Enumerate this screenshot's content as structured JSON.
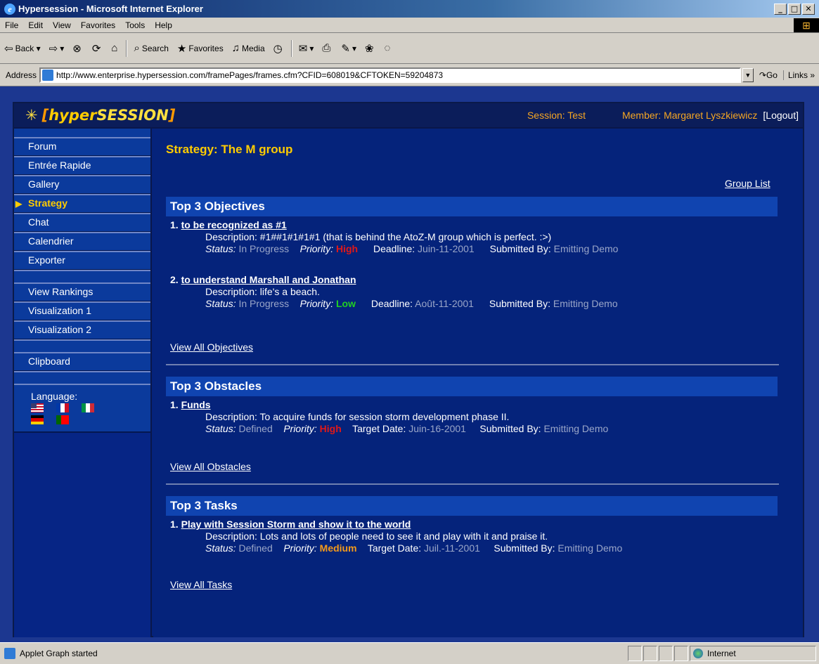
{
  "window": {
    "title": "Hypersession - Microsoft Internet Explorer"
  },
  "menu": [
    "File",
    "Edit",
    "View",
    "Favorites",
    "Tools",
    "Help"
  ],
  "toolbar": {
    "back": "Back",
    "search": "Search",
    "favorites": "Favorites",
    "media": "Media"
  },
  "address": {
    "label": "Address",
    "url": "http://www.enterprise.hypersession.com/framePages/frames.cfm?CFID=608019&CFTOKEN=59204873",
    "go": "Go",
    "links": "Links"
  },
  "header": {
    "logo_open": "[",
    "logo_hyper": "hyper",
    "logo_session": "SESSION",
    "logo_close": "]",
    "session": "Session: Test",
    "member": "Member: Margaret Lyszkiewicz",
    "logout": "[Logout]"
  },
  "sidebar": {
    "group1": [
      "Forum",
      "Entrée Rapide",
      "Gallery",
      "Strategy",
      "Chat",
      "Calendrier",
      "Exporter"
    ],
    "group2": [
      "View Rankings",
      "Visualization 1",
      "Visualization 2"
    ],
    "group3": [
      "Clipboard"
    ],
    "language_label": "Language:"
  },
  "content": {
    "page_title": "Strategy: The M group",
    "group_list": "Group List",
    "objectives": {
      "heading": "Top 3 Objectives",
      "items": [
        {
          "num": "1.",
          "title": "to be recognized as #1",
          "desc": "Description: #1##1#1#1#1 (that is behind the AtoZ-M group which is perfect. :>)",
          "status_label": "Status:",
          "status": "In Progress",
          "priority_label": "Priority:",
          "priority": "High",
          "date_label": "Deadline:",
          "date": "Juin-11-2001",
          "by_label": "Submitted By:",
          "by": "Emitting Demo"
        },
        {
          "num": "2.",
          "title": "to understand Marshall and Jonathan",
          "desc": "Description: life's a beach.",
          "status_label": "Status:",
          "status": "In Progress",
          "priority_label": "Priority:",
          "priority": "Low",
          "date_label": "Deadline:",
          "date": "Août-11-2001",
          "by_label": "Submitted By:",
          "by": "Emitting Demo"
        }
      ],
      "view_all": "View All Objectives"
    },
    "obstacles": {
      "heading": "Top 3 Obstacles",
      "items": [
        {
          "num": "1.",
          "title": "Funds",
          "desc": "Description: To acquire funds for session storm development phase II.",
          "status_label": "Status:",
          "status": "Defined",
          "priority_label": "Priority:",
          "priority": "High",
          "date_label": "Target Date:",
          "date": "Juin-16-2001",
          "by_label": "Submitted By:",
          "by": "Emitting Demo"
        }
      ],
      "view_all": "View All Obstacles"
    },
    "tasks": {
      "heading": "Top 3 Tasks",
      "items": [
        {
          "num": "1.",
          "title": "Play with Session Storm and show it to the world",
          "desc": "Description: Lots and lots of people need to see it and play with it and praise it.",
          "status_label": "Status:",
          "status": "Defined",
          "priority_label": "Priority:",
          "priority": "Medium",
          "date_label": "Target Date:",
          "date": "Juil.-11-2001",
          "by_label": "Submitted By:",
          "by": "Emitting Demo"
        }
      ],
      "view_all": "View All Tasks"
    }
  },
  "status": {
    "text": "Applet Graph started",
    "zone": "Internet"
  },
  "colors": {
    "priority_high": "#e01818",
    "priority_low": "#22d022",
    "priority_medium": "#f59a1a",
    "accent": "#ffcc00"
  }
}
